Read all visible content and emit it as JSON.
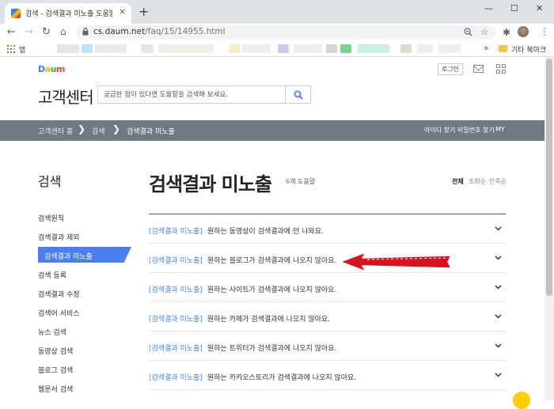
{
  "browser": {
    "tab_title": "검색 - 검색결과 미노출 도움말",
    "tab_close": "×",
    "new_tab": "+",
    "window_controls": {
      "minimize": "—",
      "maximize": "☐",
      "close": "✕"
    },
    "nav": {
      "back": "←",
      "forward": "→",
      "reload": "↻"
    },
    "url_host": "cs.daum.net",
    "url_path": "/faq/15/14955.html",
    "apps_label": "앱",
    "bookmarks_more": "»",
    "other_bookmarks": "기타 북마크",
    "icons": [
      "lock-icon",
      "zoom-icon",
      "star-icon",
      "extensions-icon",
      "profile-avatar",
      "menu-dots-icon"
    ]
  },
  "header": {
    "logo_letters": [
      "D",
      "a",
      "u",
      "m"
    ],
    "logo_colors": [
      "#3d7cf2",
      "#f5b400",
      "#2bb35a",
      "#e2452c"
    ],
    "login_label": "로그인",
    "service_title": "고객센터",
    "search_placeholder": "궁금한 점이 있다면 도움말을 검색해 보세요."
  },
  "navbar": {
    "breadcrumbs": [
      "고객센터 홈",
      "검색",
      "검색결과 미노출"
    ],
    "separator": "❯",
    "links": [
      "아이디 찾기",
      "비밀번호 찾기",
      "MY"
    ]
  },
  "sidebar": {
    "title": "검색",
    "items": [
      {
        "label": "검색원칙",
        "active": false
      },
      {
        "label": "검색결과 제외",
        "active": false
      },
      {
        "label": "검색결과 미노출",
        "active": true
      },
      {
        "label": "검색 등록",
        "active": false
      },
      {
        "label": "검색결과 수정",
        "active": false
      },
      {
        "label": "검색어 서비스",
        "active": false
      },
      {
        "label": "뉴스 검색",
        "active": false
      },
      {
        "label": "동영상 검색",
        "active": false
      },
      {
        "label": "블로그 검색",
        "active": false
      },
      {
        "label": "웹문서 검색",
        "active": false
      }
    ]
  },
  "main": {
    "title": "검색결과 미노출",
    "count_num": "6",
    "count_suffix": "개 도움말",
    "sort_options": [
      {
        "label": "전체",
        "active": true
      },
      {
        "label": "조회순",
        "active": false
      },
      {
        "label": "만족순",
        "active": false
      }
    ],
    "faq": [
      {
        "category": "[검색결과 미노출]",
        "question": "원하는 동영상이 검색결과에 안 나와요."
      },
      {
        "category": "[검색결과 미노출]",
        "question": "원하는 블로그가 검색결과에 나오지 않아요."
      },
      {
        "category": "[검색결과 미노출]",
        "question": "원하는 사이트가 검색결과에 나오지 않아요."
      },
      {
        "category": "[검색결과 미노출]",
        "question": "원하는 카페가 검색결과에 나오지 않아요."
      },
      {
        "category": "[검색결과 미노출]",
        "question": "원하는 트위터가 검색결과에 나오지 않아요."
      },
      {
        "category": "[검색결과 미노출]",
        "question": "원하는 카카오스토리가 검색결과에 나오지 않아요."
      }
    ]
  },
  "colors": {
    "accent": "#4b7ff0",
    "navbar": "#6f7984",
    "annotation_arrow": "#d9121f"
  }
}
